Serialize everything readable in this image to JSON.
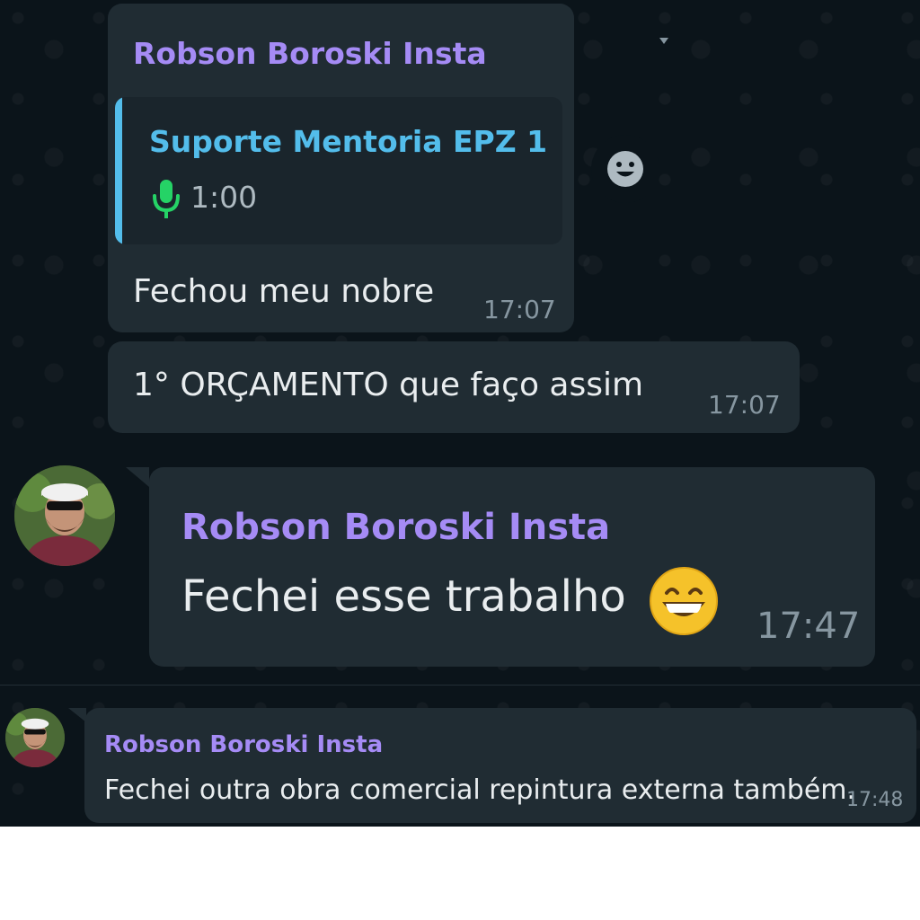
{
  "colors": {
    "background": "#0b141a",
    "bubble": "#202c33",
    "sender_name": "#a58bf5",
    "quote_accent": "#53bdeb",
    "mic_icon": "#25d366",
    "timestamp": "#8696a0",
    "message_text": "#e9edef"
  },
  "messages": [
    {
      "sender": "Robson Boroski Insta",
      "quote": {
        "title": "Suporte Mentoria EPZ 1",
        "icon": "mic-icon",
        "duration": "1:00"
      },
      "text": "Fechou meu nobre",
      "time": "17:07",
      "reaction_icon": "smiley-reaction-icon"
    },
    {
      "text": "1° ORÇAMENTO que faço assim",
      "time": "17:07"
    },
    {
      "sender": "Robson Boroski Insta",
      "avatar": "avatar",
      "text": "Fechei esse trabalho",
      "emoji": "grinning-face-emoji",
      "time": "17:47"
    },
    {
      "sender": "Robson Boroski Insta",
      "avatar": "avatar",
      "text": "Fechei outra obra comercial repintura externa também.",
      "time": "17:48"
    }
  ]
}
